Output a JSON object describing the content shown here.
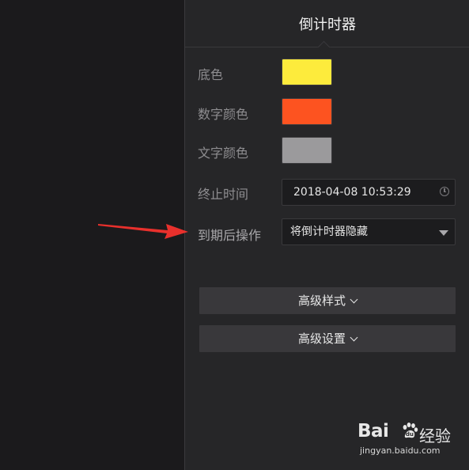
{
  "panel": {
    "title": "倒计时器"
  },
  "settings": {
    "bg_color_label": "底色",
    "bg_color_value": "#fdeb3c",
    "number_color_label": "数字颜色",
    "number_color_value": "#fd5320",
    "text_color_label": "文字颜色",
    "text_color_value": "#9b9a9c",
    "end_time_label": "终止时间",
    "end_time_value": "2018-04-08 10:53:29",
    "expire_action_label": "到期后操作",
    "expire_action_value": "将倒计时器隐藏"
  },
  "sections": {
    "advanced_style_label": "高级样式",
    "advanced_settings_label": "高级设置"
  },
  "icons": {
    "end_time": "clock-icon",
    "expire_action": "chevron-down-icon",
    "section_toggle": "chevron-down-icon",
    "annotation": "red-arrow-icon"
  },
  "colors": {
    "panel_bg": "#262628",
    "left_bg": "#1b1a1c",
    "annotation_arrow": "#e8302c"
  },
  "watermark": {
    "brand_left": "Bai",
    "brand_right": "经验",
    "url": "jingyan.baidu.com"
  }
}
